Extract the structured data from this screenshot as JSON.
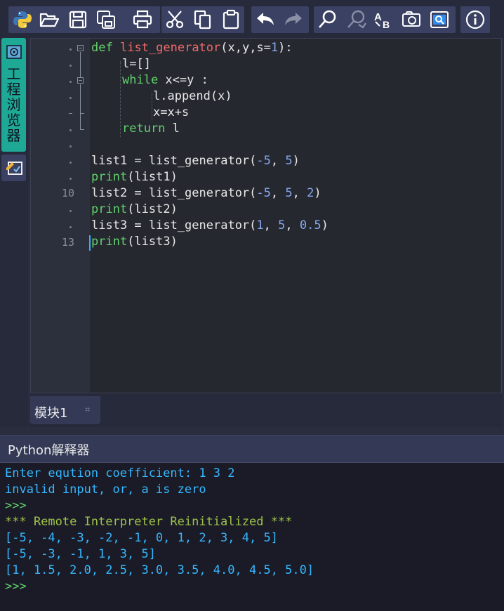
{
  "toolbar": {
    "buttons": [
      "python-logo",
      "open-folder",
      "save",
      "save-all",
      "print",
      "cut",
      "copy",
      "paste",
      "undo",
      "redo",
      "find",
      "find-replace",
      "spell-check",
      "screenshot",
      "search-window",
      "info"
    ]
  },
  "sidebar": {
    "project_browser_label": "工程浏览器"
  },
  "editor": {
    "line_numbers": [
      "10",
      "13"
    ],
    "code": {
      "l1_def": "def",
      "l1_fn": "list_generator",
      "l1_args_a": "(x,y,s=",
      "l1_num": "1",
      "l1_args_b": "):",
      "l2": "l=[]",
      "l3_kw": "while",
      "l3_rest": " x<=y :",
      "l4": "l.append(x)",
      "l5": "x=x+s",
      "l6_kw": "return",
      "l6_rest": " l",
      "l8_a": "list1 = list_generator(",
      "l8_n1": "-5",
      "l8_c": ", ",
      "l8_n2": "5",
      "l8_e": ")",
      "l9_fn": "print",
      "l9_rest": "(list1)",
      "l10_a": "list2 = list_generator(",
      "l10_n1": "-5",
      "l10_c1": ", ",
      "l10_n2": "5",
      "l10_c2": ", ",
      "l10_n3": "2",
      "l10_e": ")",
      "l11_fn": "print",
      "l11_rest": "(list2)",
      "l12_a": "list3 = list_generator(",
      "l12_n1": "1",
      "l12_c1": ", ",
      "l12_n2": "5",
      "l12_c2": ", ",
      "l12_n3": "0.5",
      "l12_e": ")",
      "l13_fn": "print",
      "l13_rest": "(list3)"
    }
  },
  "module_tab": {
    "label": "模块1",
    "close": "⌗"
  },
  "interpreter": {
    "title": "Python解释器",
    "lines": [
      "Enter eqution coefficient: 1 3 2",
      "invalid input, or, a is zero",
      ">>>",
      "*** Remote Interpreter Reinitialized ***",
      "[-5, -4, -3, -2, -1, 0, 1, 2, 3, 4, 5]",
      "[-5, -3, -1, 1, 3, 5]",
      "[1, 1.5, 2.0, 2.5, 3.0, 3.5, 4.0, 4.5, 5.0]",
      ">>>"
    ]
  },
  "colors": {
    "accent_teal": "#1ea896",
    "keyword_green": "#62d26c",
    "function_red": "#f06a6a",
    "number_blue": "#86a8f0",
    "console_blue": "#36b7ff"
  }
}
